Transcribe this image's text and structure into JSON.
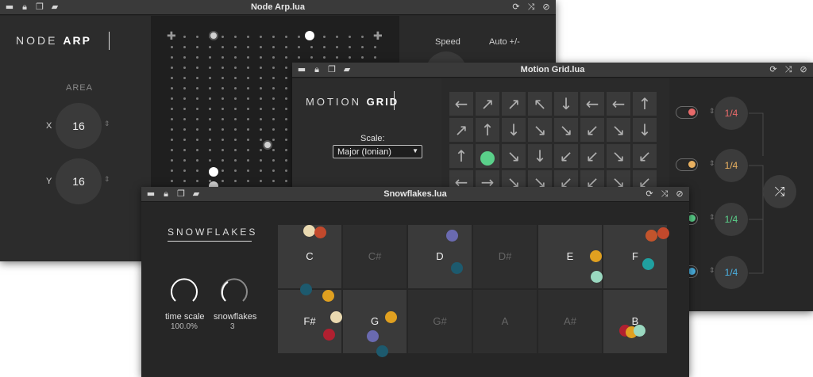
{
  "node_arp": {
    "title": "Node Arp.lua",
    "logo_light": "NODE ",
    "logo_bold": "ARP",
    "area_label": "AREA",
    "x_label": "X",
    "x_value": "16",
    "y_label": "Y",
    "y_value": "16",
    "speed_label": "Speed",
    "auto_label": "Auto +/-"
  },
  "motion_grid": {
    "title": "Motion Grid.lua",
    "logo_light": "MOTION ",
    "logo_bold": "GRID",
    "scale_label": "Scale:",
    "scale_value": "Major (Ionian)",
    "arrows_row1": [
      "←",
      "↗",
      "↗",
      "↖",
      "↓",
      "←",
      "←",
      "↑"
    ],
    "arrows_row2": [
      "↗",
      "↑",
      "↓",
      "↘",
      "↘",
      "↙",
      "↘",
      "↓"
    ],
    "arrows_row3": [
      "↑",
      "",
      "↘",
      "↓",
      "↙",
      "↙",
      "↘",
      "↙"
    ],
    "arrows_row4": [
      "←",
      "→",
      "↘",
      "↘",
      "↙",
      "↙",
      "↘",
      "↙"
    ],
    "rates": [
      {
        "value": "1/4",
        "color": "#e86a6a"
      },
      {
        "value": "1/4",
        "color": "#e8b060"
      },
      {
        "value": "1/4",
        "color": "#5ad08a"
      },
      {
        "value": "1/4",
        "color": "#4ab0e0"
      }
    ],
    "shuffle_icon": "shuffle-icon"
  },
  "snowflakes": {
    "title": "Snowflakes.lua",
    "logo": "SNOWFLAKES",
    "time_scale_label": "time scale",
    "time_scale_value": "100.0%",
    "snowflakes_label": "snowflakes",
    "snowflakes_value": "3",
    "notes_row1": [
      "C",
      "C#",
      "D",
      "D#",
      "E",
      "F"
    ],
    "notes_row2": [
      "F#",
      "G",
      "G#",
      "A",
      "A#",
      "B"
    ]
  }
}
